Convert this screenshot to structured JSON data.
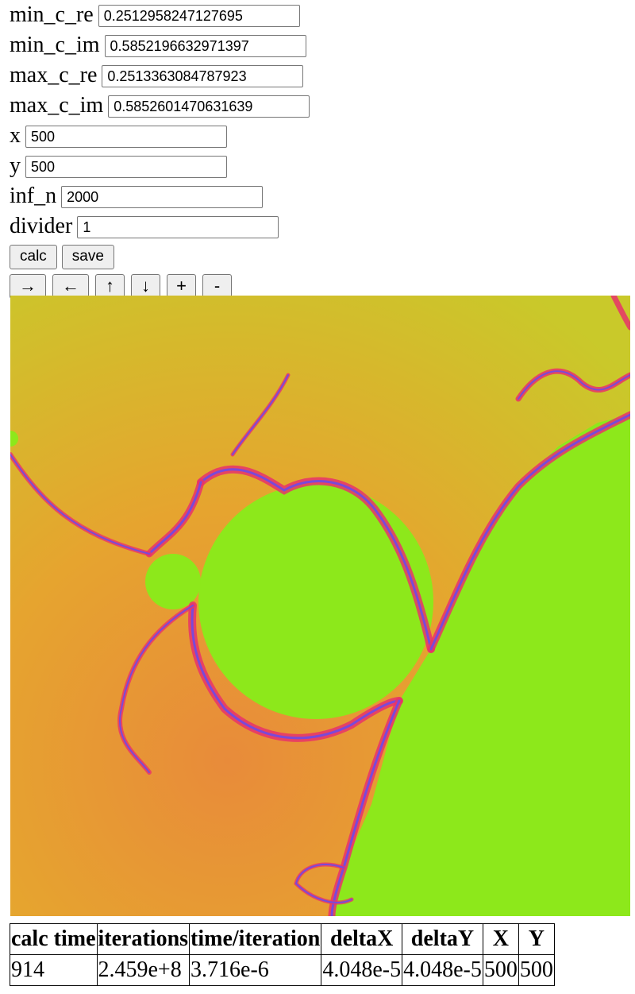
{
  "params": [
    {
      "label": "min_c_re",
      "value": "0.2512958247127695"
    },
    {
      "label": "min_c_im",
      "value": "0.5852196632971397"
    },
    {
      "label": "max_c_re",
      "value": "0.2513363084787923"
    },
    {
      "label": "max_c_im",
      "value": "0.5852601470631639"
    },
    {
      "label": "x",
      "value": "500"
    },
    {
      "label": "y",
      "value": "500"
    },
    {
      "label": "inf_n",
      "value": "2000"
    },
    {
      "label": "divider",
      "value": "1"
    }
  ],
  "actions": {
    "calc": "calc",
    "save": "save"
  },
  "nav": {
    "right": "→",
    "left": "←",
    "up": "↑",
    "down": "↓",
    "zoom_in": "+",
    "zoom_out": "-"
  },
  "colors": {
    "inside": "#8de81b",
    "outer": "#e3b12a",
    "edge": "#e8336a",
    "filament": "#7a49d8"
  },
  "stats": {
    "headers": [
      "calc time",
      "iterations",
      "time/iteration",
      "deltaX",
      "deltaY",
      "X",
      "Y"
    ],
    "values": [
      "914",
      "2.459e+8",
      "3.716e-6",
      "4.048e-5",
      "4.048e-5",
      "500",
      "500"
    ]
  }
}
